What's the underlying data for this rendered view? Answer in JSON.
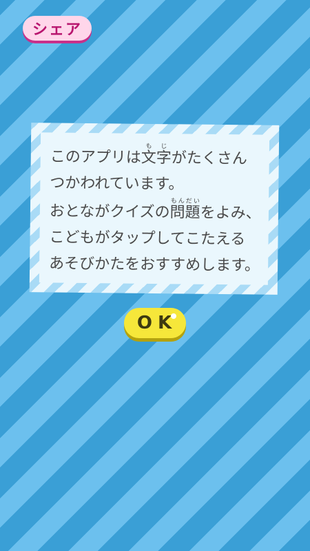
{
  "share": {
    "label": "シェア"
  },
  "notice": {
    "line1": {
      "before": "このアプリは",
      "base": "文字",
      "ruby": "もじ",
      "after": "がたくさん"
    },
    "line2": "つかわれています。",
    "line3": {
      "before": "おとながクイズの",
      "base": "問題",
      "ruby": "もんだい",
      "after": "をよみ、"
    },
    "line4": "こどもがタップしてこたえる",
    "line5": "あそびかたをおすすめします。"
  },
  "ok": {
    "label": "OK"
  },
  "colors": {
    "background": "#3a9fd6",
    "stripe": "#6cc0ee",
    "share_bg": "#ffd6ea",
    "share_text": "#b8156e",
    "ok_bg": "#f6e73a",
    "text": "#4a4a4a"
  }
}
